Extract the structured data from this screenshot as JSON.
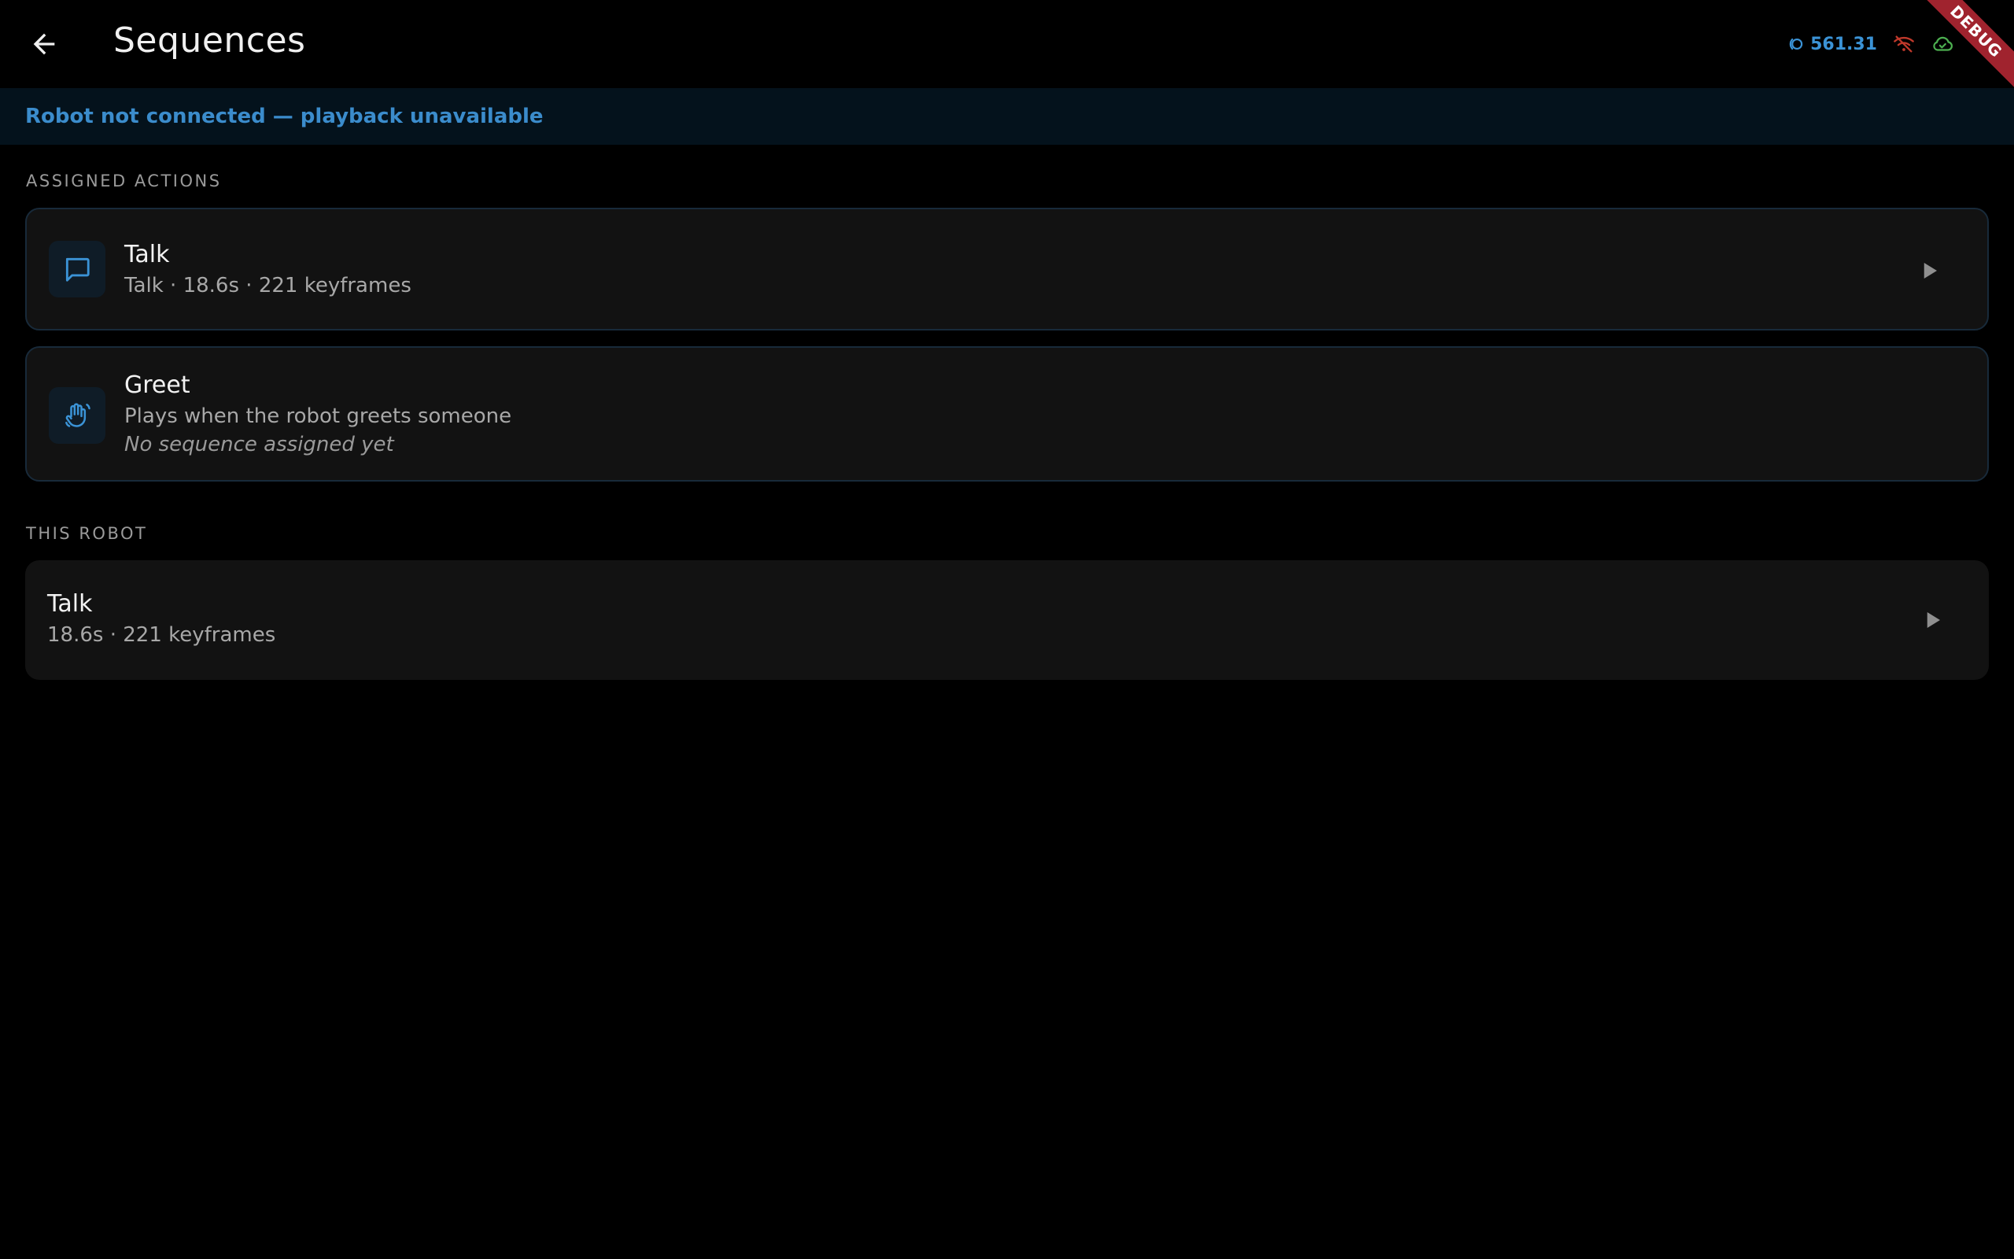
{
  "app_bar": {
    "title": "Sequences",
    "back_icon": "arrow-left-icon"
  },
  "status": {
    "latency_icon": "signal-icon",
    "latency_value": "561.31",
    "latency_color": "#3b93d6",
    "wifi_icon": "wifi-off-icon",
    "wifi_color": "#c0392b",
    "cloud_icon": "cloud-check-icon",
    "cloud_color": "#4caf50"
  },
  "debug_banner": "DEBUG",
  "connection_banner": {
    "text": "Robot not connected — playback unavailable",
    "color": "#3b8ccc"
  },
  "assigned_actions": {
    "header": "ASSIGNED ACTIONS",
    "items": [
      {
        "icon": "chat-bubble-icon",
        "title": "Talk",
        "subtitle": "Talk · 18.6s · 221 keyframes",
        "play_icon": "play-icon"
      },
      {
        "icon": "waving-hand-icon",
        "title": "Greet",
        "subtitle": "Plays when the robot greets someone",
        "note": "No sequence assigned yet"
      }
    ]
  },
  "this_robot": {
    "header": "THIS ROBOT",
    "items": [
      {
        "title": "Talk",
        "subtitle": "18.6s · 221 keyframes",
        "play_icon": "play-icon"
      }
    ]
  },
  "colors": {
    "accent": "#3b93d6",
    "background": "#000000",
    "card": "#121212",
    "card_border": "#182a3a",
    "debug_ribbon": "#a0232e"
  }
}
